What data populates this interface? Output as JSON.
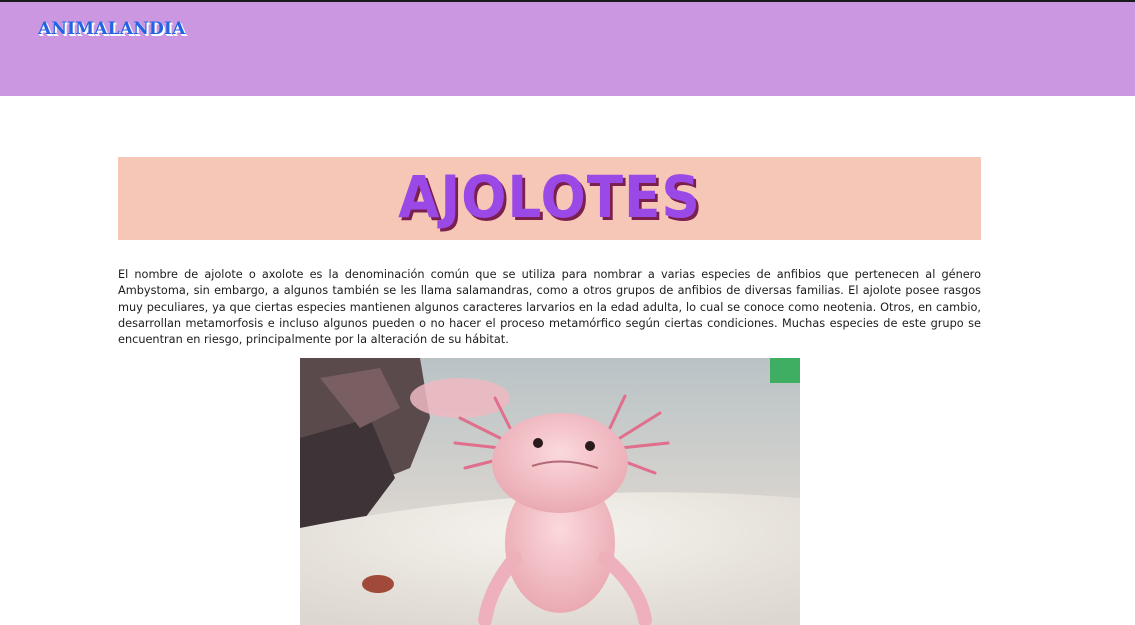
{
  "site": {
    "brand": "ANIMALANDIA"
  },
  "article": {
    "title": "AJOLOTES",
    "paragraph": "El nombre de ajolote o axolote es la denominación común que se utiliza para nombrar a varias especies de anfibios que pertenecen al género Ambystoma, sin embargo, a algunos también se les llama salamandras, como a otros grupos de anfibios de diversas familias. El ajolote posee rasgos muy peculiares, ya que ciertas especies mantienen algunos caracteres larvarios en la edad adulta, lo cual se conoce como neotenia. Otros, en cambio, desarrollan metamorfosis e incluso algunos pueden o no hacer el proceso metamórfico según ciertas condiciones. Muchas especies de este grupo se encuentran en riesgo, principalmente por la alteración de su hábitat."
  },
  "colors": {
    "header_bg": "#ca97e0",
    "brand": "#2463e3",
    "title_band": "#f6c7b6",
    "title_text": "#9b49e6",
    "title_shadow": "#7b1f4f"
  },
  "image": {
    "subject": "pink-axolotl-photo"
  }
}
